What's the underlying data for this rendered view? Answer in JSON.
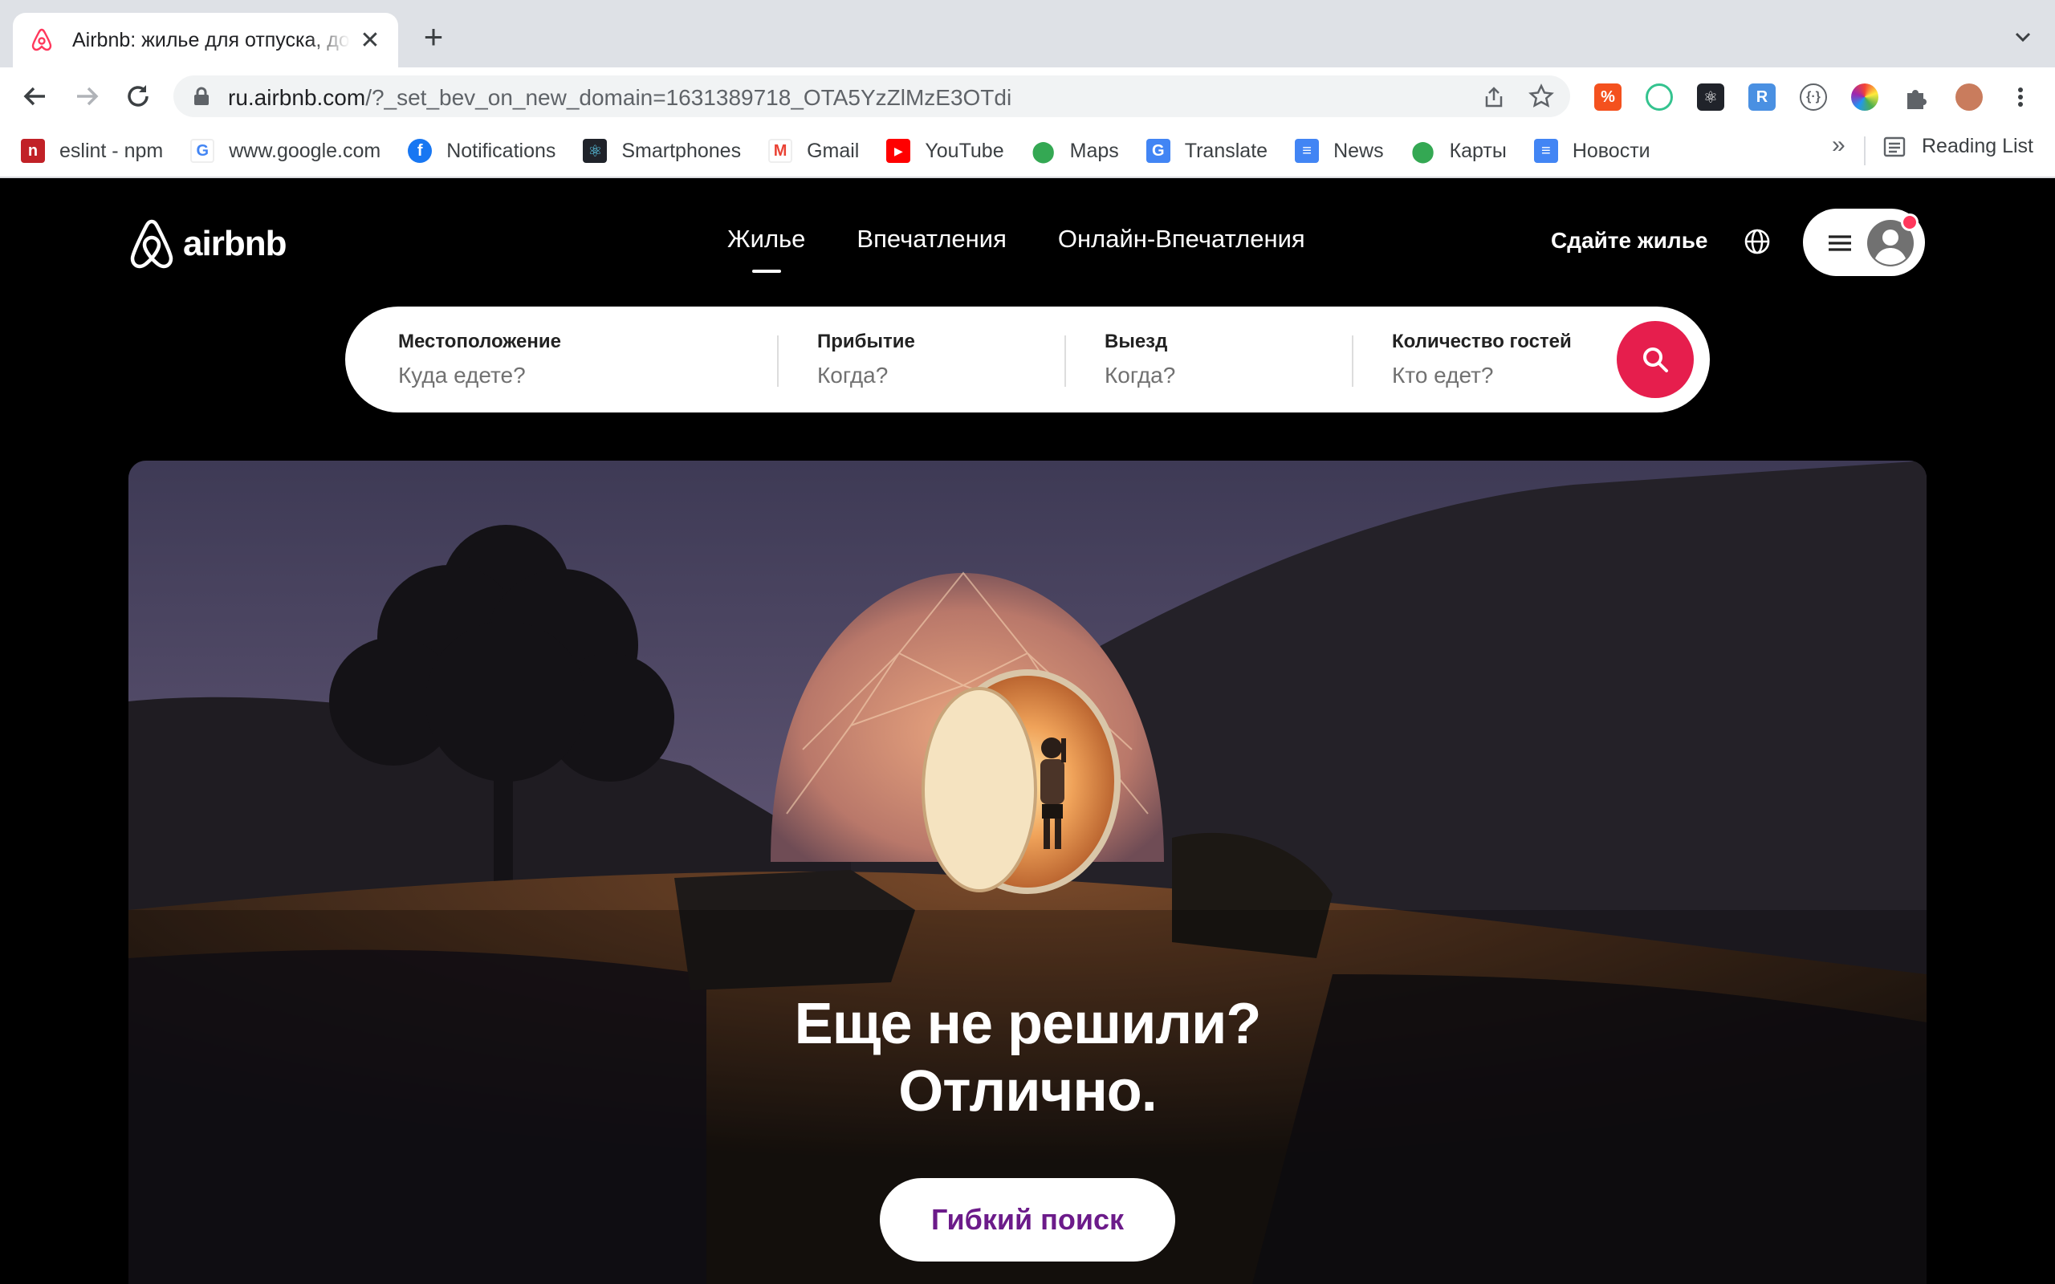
{
  "browser": {
    "tab_title": "Airbnb: жилье для отпуска, дома, квартиры",
    "new_tab": "+",
    "close": "✕",
    "url_host": "ru.airbnb.com",
    "url_path": "/?_set_bev_on_new_domain=1631389718_OTA5YzZlMzE3OTdi",
    "bookmarks": [
      {
        "label": "eslint - npm",
        "icon": "npm-icon",
        "color": "#c12127"
      },
      {
        "label": "www.google.com",
        "icon": "google-icon",
        "color": "#4285f4"
      },
      {
        "label": "Notifications",
        "icon": "facebook-icon",
        "color": "#1877f2"
      },
      {
        "label": "Smartphones",
        "icon": "react-icon",
        "color": "#20232a"
      },
      {
        "label": "Gmail",
        "icon": "gmail-icon",
        "color": "#ea4335"
      },
      {
        "label": "YouTube",
        "icon": "youtube-icon",
        "color": "#ff0000"
      },
      {
        "label": "Maps",
        "icon": "maps-icon",
        "color": "#34a853"
      },
      {
        "label": "Translate",
        "icon": "translate-icon",
        "color": "#4285f4"
      },
      {
        "label": "News",
        "icon": "news-icon",
        "color": "#4285f4"
      },
      {
        "label": "Карты",
        "icon": "maps-icon",
        "color": "#34a853"
      },
      {
        "label": "Новости",
        "icon": "news-icon",
        "color": "#4285f4"
      }
    ],
    "bookmarks_more": "»",
    "reading_list": "Reading List"
  },
  "header": {
    "logo_text": "airbnb",
    "nav": [
      "Жилье",
      "Впечатления",
      "Онлайн-Впечатления"
    ],
    "host_link": "Сдайте жилье"
  },
  "search": {
    "location_label": "Местоположение",
    "location_placeholder": "Куда едете?",
    "checkin_label": "Прибытие",
    "checkin_placeholder": "Когда?",
    "checkout_label": "Выезд",
    "checkout_placeholder": "Когда?",
    "guests_label": "Количество гостей",
    "guests_placeholder": "Кто едет?"
  },
  "hero": {
    "line1": "Еще не решили?",
    "line2": "Отлично.",
    "button": "Гибкий поиск"
  },
  "colors": {
    "brand": "#ff385c",
    "search_button": "#e61e4d",
    "flex_button_text": "#6c1b8a"
  }
}
